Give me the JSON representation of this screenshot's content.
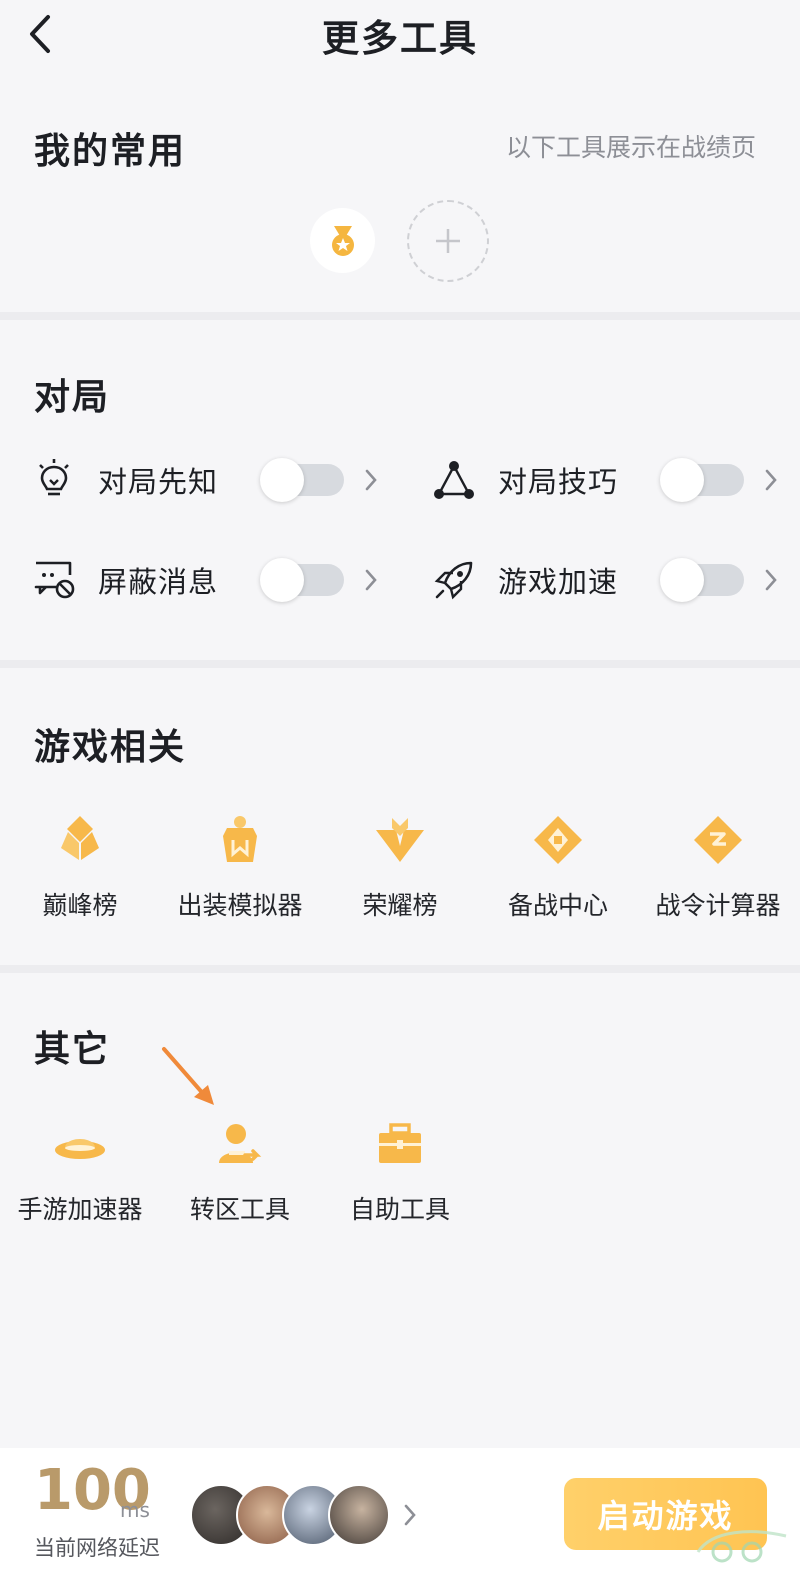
{
  "header": {
    "title": "更多工具"
  },
  "favorites": {
    "title": "我的常用",
    "hint": "以下工具展示在战绩页",
    "items": [
      {
        "icon": "medal-icon"
      }
    ],
    "add_icon": "plus-icon"
  },
  "match": {
    "title": "对局",
    "toggles": [
      {
        "label": "对局先知",
        "icon": "lightbulb-icon",
        "on": false
      },
      {
        "label": "对局技巧",
        "icon": "triangle-nodes-icon",
        "on": false
      },
      {
        "label": "屏蔽消息",
        "icon": "message-block-icon",
        "on": false
      },
      {
        "label": "游戏加速",
        "icon": "rocket-icon",
        "on": false
      }
    ]
  },
  "game": {
    "title": "游戏相关",
    "items": [
      {
        "label": "巅峰榜",
        "icon": "peak-rank-icon"
      },
      {
        "label": "出装模拟器",
        "icon": "equipment-sim-icon"
      },
      {
        "label": "荣耀榜",
        "icon": "glory-rank-icon"
      },
      {
        "label": "备战中心",
        "icon": "prep-center-icon"
      },
      {
        "label": "战令计算器",
        "icon": "pass-calculator-icon"
      }
    ]
  },
  "others": {
    "title": "其它",
    "items": [
      {
        "label": "手游加速器",
        "icon": "ufo-accelerator-icon"
      },
      {
        "label": "转区工具",
        "icon": "user-transfer-icon"
      },
      {
        "label": "自助工具",
        "icon": "toolbox-icon"
      }
    ]
  },
  "footer": {
    "ping_value": "100",
    "ping_unit": "ms",
    "ping_label": "当前网络延迟",
    "start_label": "启动游戏",
    "friend_avatars": 4
  },
  "colors": {
    "accent": "#ffc452",
    "icon_gold": "#f7b84a",
    "ping": "#b99a6a"
  }
}
